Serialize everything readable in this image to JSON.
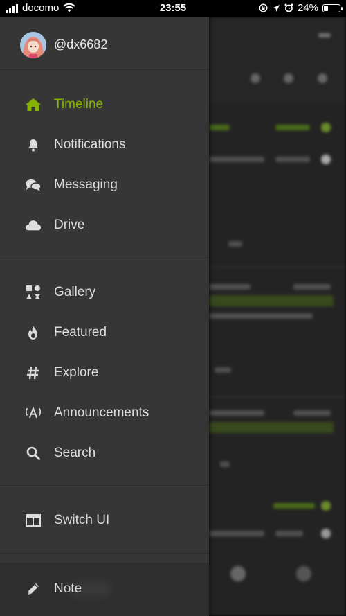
{
  "status_bar": {
    "carrier": "docomo",
    "time": "23:55",
    "battery": "24%"
  },
  "profile": {
    "username": "@dx6682"
  },
  "colors": {
    "accent": "#86b300",
    "drawer_bg": "#363636",
    "text": "#dcdcdc"
  },
  "nav": {
    "primary": [
      {
        "label": "Timeline",
        "icon": "home-icon",
        "active": true
      },
      {
        "label": "Notifications",
        "icon": "bell-icon"
      },
      {
        "label": "Messaging",
        "icon": "comments-icon"
      },
      {
        "label": "Drive",
        "icon": "cloud-icon"
      }
    ],
    "secondary": [
      {
        "label": "Gallery",
        "icon": "gallery-icon"
      },
      {
        "label": "Featured",
        "icon": "fire-icon"
      },
      {
        "label": "Explore",
        "icon": "hashtag-icon"
      },
      {
        "label": "Announcements",
        "icon": "broadcast-icon"
      },
      {
        "label": "Search",
        "icon": "search-icon"
      }
    ],
    "switch_ui": {
      "label": "Switch UI",
      "icon": "columns-icon"
    },
    "note": {
      "label": "Note",
      "icon": "pencil-icon"
    }
  }
}
